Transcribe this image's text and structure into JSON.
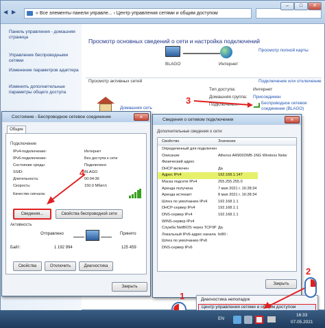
{
  "explorer": {
    "address": "« Все элементы панели управле... › Центр управления сетями и общим доступом",
    "back": "◀",
    "fwd": "▶"
  },
  "window_controls": {
    "min": "–",
    "max": "□",
    "close": "✕"
  },
  "sidebar": {
    "items": [
      {
        "label": "Панель управления - домашняя страница"
      },
      {
        "label": "Управление беспроводными сетями"
      },
      {
        "label": "Изменение параметров адаптера"
      },
      {
        "label": "Изменить дополнительные параметры общего доступа"
      }
    ]
  },
  "main": {
    "title": "Просмотр основных сведений о сети и настройка подключений",
    "full_map": "Просмотр полной карты",
    "map": {
      "computer": "BLAGO",
      "internet": "Интернет"
    },
    "active_label": "Просмотр активных сетей",
    "connect_link": "Подключение или отключение",
    "network_name": "Домашняя сеть",
    "props": [
      {
        "label": "Тип доступа:",
        "value": "Интернет"
      },
      {
        "label": "Домашняя группа:",
        "value": "Присоединен"
      },
      {
        "label": "Подключения:",
        "value": "Беспроводное сетевое соединение (BLAGO)"
      }
    ]
  },
  "status_dialog": {
    "title": "Состояние - Беспроводное сетевое соединение",
    "tab": "Общие",
    "connection_header": "Подключение",
    "rows": [
      {
        "label": "IPv4-подключение:",
        "value": "Интернет"
      },
      {
        "label": "IPv6-подключение:",
        "value": "Без доступа к сети"
      },
      {
        "label": "Состояние среды:",
        "value": "Подключено"
      },
      {
        "label": "SSID:",
        "value": "BLAGO"
      },
      {
        "label": "Длительность:",
        "value": "00:04:36"
      },
      {
        "label": "Скорость:",
        "value": "150.0 Мбит/с"
      }
    ],
    "signal": "Качество сигнала:",
    "details_btn": "Сведения...",
    "wireless_btn": "Свойства беспроводной сети",
    "activity_header": "Активность",
    "sent": "Отправлено",
    "received": "Принято",
    "bytes_label": "Байт:",
    "bytes_sent": "1 192 994",
    "bytes_received": "125 459",
    "props_btn": "Свойства",
    "disable_btn": "Отключить",
    "diag_btn": "Диагностика",
    "close_btn": "Закрыть"
  },
  "details_dialog": {
    "title": "Сведения о сетевом подключении",
    "header": "Дополнительные сведения о сети:",
    "col1": "Свойство",
    "col2": "Значение",
    "rows": [
      {
        "prop": "Определенный для подключения DN",
        "val": ""
      },
      {
        "prop": "Описание",
        "val": "Atheros AR9002WB-1NG Wireless Netw"
      },
      {
        "prop": "Физический адрес",
        "val": ""
      },
      {
        "prop": "DHCP включен",
        "val": "Да"
      },
      {
        "prop": "Адрес IPv4",
        "val": "192.168.1.147"
      },
      {
        "prop": "Маска подсети IPv4",
        "val": "255.255.255.0"
      },
      {
        "prop": "Аренда получена",
        "val": "7 мая 2021 г. 16:28:34"
      },
      {
        "prop": "Аренда истекает",
        "val": "8 мая 2021 г. 16:28:34"
      },
      {
        "prop": "Шлюз по умолчанию IPv4",
        "val": "192.168.1.1"
      },
      {
        "prop": "DHCP-сервер IPv4",
        "val": "192.168.1.1"
      },
      {
        "prop": "DNS-сервер IPv4",
        "val": "192.168.1.1"
      },
      {
        "prop": "WINS-сервер IPv4",
        "val": ""
      },
      {
        "prop": "Служба NetBIOS через TCP/IP в",
        "val": "Да"
      },
      {
        "prop": "Локальный IPv6-адрес канала",
        "val": "fe80::"
      },
      {
        "prop": "Шлюз по умолчанию IPv6",
        "val": ""
      },
      {
        "prop": "DNS-сервер IPv6",
        "val": ""
      }
    ],
    "close_btn": "Закрыть"
  },
  "context_menu": {
    "items": [
      {
        "label": "Диагностика неполадок"
      },
      {
        "label": "Центр управления сетями и общим доступом"
      }
    ]
  },
  "taskbar": {
    "lang": "EN",
    "time": "16:33",
    "date": "07.05.2021"
  },
  "steps": {
    "s1": "1",
    "s2": "2",
    "s3": "3",
    "s4": "4"
  }
}
